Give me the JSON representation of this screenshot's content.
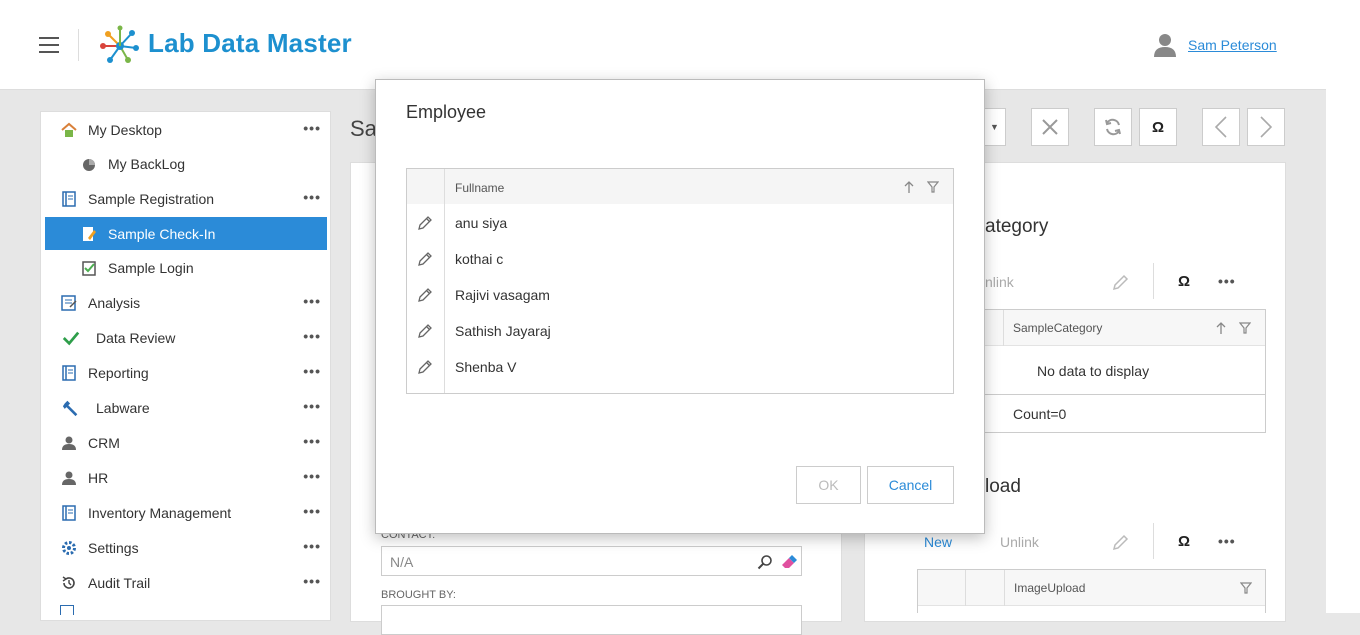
{
  "header": {
    "app_title": "Lab Data Master",
    "user_name": "Sam Peterson"
  },
  "sidebar": {
    "items": [
      {
        "label": "My Desktop",
        "icon": "home-icon",
        "more": "•••"
      },
      {
        "label": "My BackLog",
        "icon": "pie-chart-icon"
      },
      {
        "label": "Sample Registration",
        "icon": "book-icon",
        "more": "•••"
      },
      {
        "label": "Sample Check-In",
        "icon": "pencil-note-icon",
        "active": true
      },
      {
        "label": "Sample Login",
        "icon": "checklist-icon"
      },
      {
        "label": "Analysis",
        "icon": "report-icon",
        "more": "•••"
      },
      {
        "label": "Data Review",
        "icon": "checkmark-icon",
        "more": "•••"
      },
      {
        "label": "Reporting",
        "icon": "book-icon",
        "more": "•••"
      },
      {
        "label": "Labware",
        "icon": "wrench-icon",
        "more": "•••"
      },
      {
        "label": "CRM",
        "icon": "person-icon",
        "more": "•••"
      },
      {
        "label": "HR",
        "icon": "person-icon",
        "more": "•••"
      },
      {
        "label": "Inventory Management",
        "icon": "book-icon",
        "more": "•••"
      },
      {
        "label": "Settings",
        "icon": "gear-icon",
        "more": "•••"
      },
      {
        "label": "Audit Trail",
        "icon": "history-icon",
        "more": "•••"
      }
    ]
  },
  "background": {
    "page_title_partial": "Sa",
    "category_title_partial": "ategory",
    "category_unlink_partial": "nlink",
    "category_col": "SampleCategory",
    "category_empty": "No data to display",
    "category_count": "Count=0",
    "upload_title_partial": "load",
    "upload_new": "New",
    "upload_unlink": "Unlink",
    "upload_col": "ImageUpload",
    "contact_label": "CONTACT:",
    "contact_value": "N/A",
    "brought_by_label": "BROUGHT BY:",
    "omega": "Ω",
    "dots": "•••"
  },
  "modal": {
    "title": "Employee",
    "column": "Fullname",
    "rows": [
      "anu siya",
      "kothai c",
      "Rajivi vasagam",
      "Sathish Jayaraj",
      "Shenba V"
    ],
    "ok_label": "OK",
    "cancel_label": "Cancel"
  }
}
